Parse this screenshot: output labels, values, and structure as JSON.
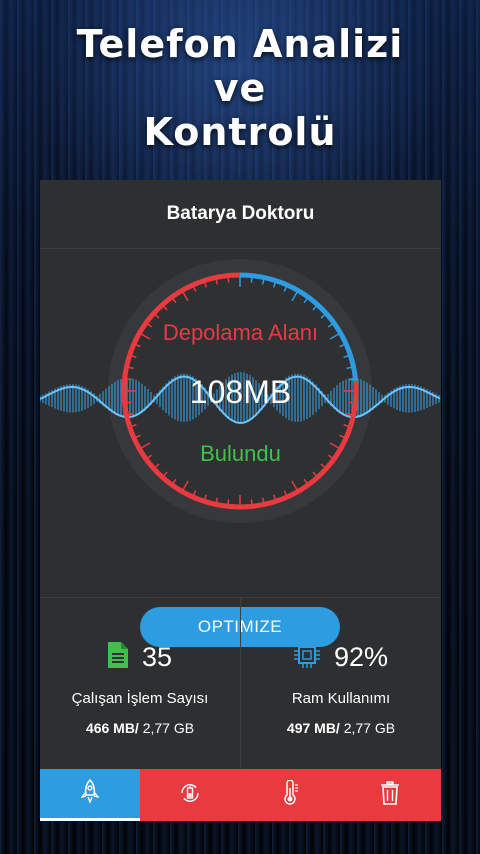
{
  "hero": {
    "line1": "Telefon Analizi",
    "line2": "ve",
    "line3": "Kontrolü"
  },
  "header": {
    "title": "Batarya Doktoru"
  },
  "gauge": {
    "label_top": "Depolama Alanı",
    "value": "108MB",
    "label_bottom": "Bulundu"
  },
  "optimize_button": "OPTIMIZE",
  "stats": {
    "processes": {
      "value": "35",
      "label": "Çalışan İşlem Sayısı",
      "mem_used": "466 MB/",
      "mem_total": " 2,77 GB"
    },
    "ram": {
      "value": "92%",
      "label": "Ram Kullanımı",
      "mem_used": "497 MB/",
      "mem_total": " 2,77 GB"
    }
  },
  "colors": {
    "accent_blue": "#2d9ce0",
    "accent_red": "#e93a40",
    "green": "#3fc14b",
    "card_bg": "#2e2f31"
  },
  "nav": [
    {
      "icon": "rocket-icon",
      "active": true
    },
    {
      "icon": "battery-refresh-icon",
      "active": false
    },
    {
      "icon": "thermometer-icon",
      "active": false
    },
    {
      "icon": "trash-icon",
      "active": false
    }
  ]
}
